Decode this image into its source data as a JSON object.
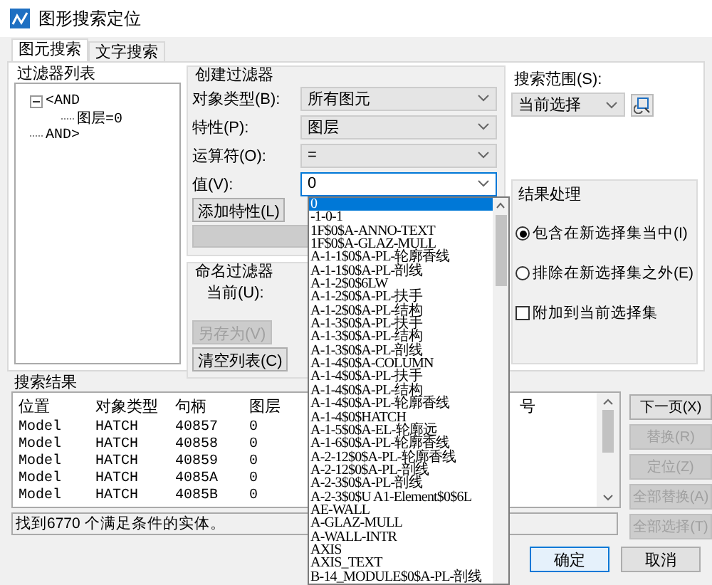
{
  "window": {
    "title": "图形搜索定位"
  },
  "tabs": [
    {
      "label": "图元搜索",
      "selected": true
    },
    {
      "label": "文字搜索",
      "selected": false
    }
  ],
  "filter_list": {
    "title": "过滤器列表",
    "tree": [
      {
        "label": "<AND",
        "expanded": true,
        "children": [
          {
            "label": "图层=0"
          }
        ]
      },
      {
        "label": "AND>"
      }
    ]
  },
  "create_filter": {
    "title": "创建过滤器",
    "fields": [
      {
        "label": "对象类型(B):",
        "value": "所有图元",
        "focused": false
      },
      {
        "label": "特性(P):",
        "value": "图层",
        "focused": false
      },
      {
        "label": "运算符(O):",
        "value": "=",
        "focused": false
      },
      {
        "label": "值(V):",
        "value": "0",
        "focused": true
      }
    ],
    "add_button": "添加特性(L)"
  },
  "value_dropdown": {
    "items": [
      {
        "label": "0",
        "selected": true
      },
      {
        "label": "-1-0-1",
        "selected": false
      },
      {
        "label": "1F$0$A-ANNO-TEXT",
        "selected": false
      },
      {
        "label": "1F$0$A-GLAZ-MULL",
        "selected": false
      },
      {
        "label": "A-1-1$0$A-PL-轮廓香线",
        "selected": false
      },
      {
        "label": "A-1-1$0$A-PL-剖线",
        "selected": false
      },
      {
        "label": "A-1-2$0$6LW",
        "selected": false
      },
      {
        "label": "A-1-2$0$A-PL-扶手",
        "selected": false
      },
      {
        "label": "A-1-2$0$A-PL-结构",
        "selected": false
      },
      {
        "label": "A-1-3$0$A-PL-扶手",
        "selected": false
      },
      {
        "label": "A-1-3$0$A-PL-结构",
        "selected": false
      },
      {
        "label": "A-1-3$0$A-PL-剖线",
        "selected": false
      },
      {
        "label": "A-1-4$0$A-COLUMN",
        "selected": false
      },
      {
        "label": "A-1-4$0$A-PL-扶手",
        "selected": false
      },
      {
        "label": "A-1-4$0$A-PL-结构",
        "selected": false
      },
      {
        "label": "A-1-4$0$A-PL-轮廓香线",
        "selected": false
      },
      {
        "label": "A-1-4$0$HATCH",
        "selected": false
      },
      {
        "label": "A-1-5$0$A-EL-轮廓远",
        "selected": false
      },
      {
        "label": "A-1-6$0$A-PL-轮廓香线",
        "selected": false
      },
      {
        "label": "A-2-12$0$A-PL-轮廓香线",
        "selected": false
      },
      {
        "label": "A-2-12$0$A-PL-剖线",
        "selected": false
      },
      {
        "label": "A-2-3$0$A-PL-剖线",
        "selected": false
      },
      {
        "label": "A-2-3$0$U A1-Element$0$6L",
        "selected": false
      },
      {
        "label": "AE-WALL",
        "selected": false
      },
      {
        "label": "A-GLAZ-MULL",
        "selected": false
      },
      {
        "label": "A-WALL-INTR",
        "selected": false
      },
      {
        "label": "AXIS",
        "selected": false
      },
      {
        "label": "AXIS_TEXT",
        "selected": false
      },
      {
        "label": "B-14_MODULE$0$A-PL-剖线",
        "selected": false
      }
    ]
  },
  "named_filter": {
    "title": "命名过滤器",
    "current_label": "当前(U):",
    "buttons": [
      {
        "label": "另存为(V)",
        "disabled": true
      },
      {
        "label": "清空列表(C)",
        "disabled": false
      }
    ]
  },
  "search_scope": {
    "label": "搜索范围(S):",
    "value": "当前选择"
  },
  "result_handling": {
    "title": "结果处理",
    "options": [
      {
        "kind": "radio",
        "label": "包含在新选择集当中(I)",
        "selected": true
      },
      {
        "kind": "radio",
        "label": "排除在新选择集之外(E)",
        "selected": false
      },
      {
        "kind": "checkbox",
        "label": "附加到当前选择集",
        "checked": false
      }
    ]
  },
  "results": {
    "title": "搜索结果",
    "columns": [
      "位置",
      "对象类型",
      "句柄",
      "图层",
      "号"
    ],
    "rows": [
      [
        "Model",
        "HATCH",
        "40857",
        "0"
      ],
      [
        "Model",
        "HATCH",
        "40858",
        "0"
      ],
      [
        "Model",
        "HATCH",
        "40859",
        "0"
      ],
      [
        "Model",
        "HATCH",
        "4085A",
        "0"
      ],
      [
        "Model",
        "HATCH",
        "4085B",
        "0"
      ]
    ],
    "status": "找到6770 个满足条件的实体。"
  },
  "side_buttons": [
    {
      "label": "下一页(X)",
      "disabled": false
    },
    {
      "label": "替换(R)",
      "disabled": true
    },
    {
      "label": "定位(Z)",
      "disabled": true
    },
    {
      "label": "全部替换(A)",
      "disabled": true
    },
    {
      "label": "全部选择(T)",
      "disabled": true
    }
  ],
  "footer_buttons": [
    {
      "label": "确定",
      "focused": true
    },
    {
      "label": "取消",
      "focused": false
    }
  ]
}
